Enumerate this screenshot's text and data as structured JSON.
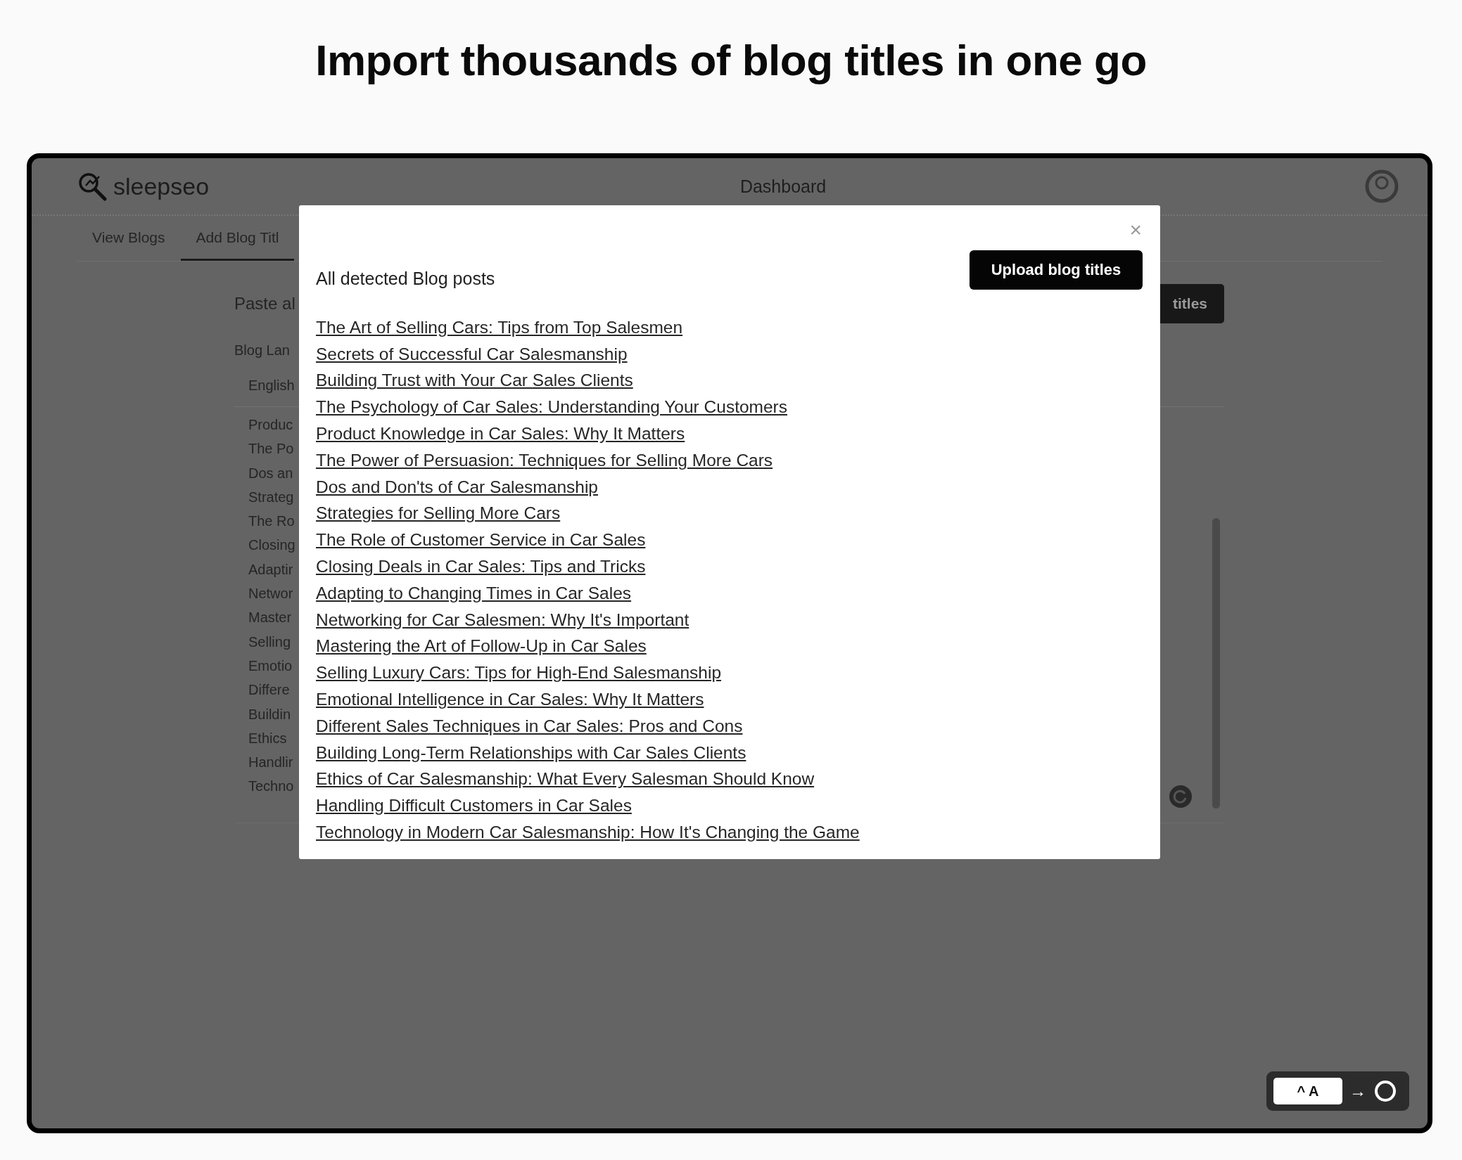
{
  "heading": "Import thousands of blog titles in one go",
  "app": {
    "logo": "sleepseo",
    "title": "Dashboard",
    "tabs": [
      {
        "label": "View Blogs",
        "selected": false
      },
      {
        "label": "Add Blog Titl",
        "selected": true
      }
    ],
    "form": {
      "prompt": "Paste al",
      "button": "titles",
      "language_label": "Blog Lan",
      "language_value": "English",
      "titles": [
        "Produc",
        "The Po",
        "Dos an",
        "Strateg",
        "The Ro",
        "Closing",
        "Adaptir",
        "Networ",
        "Master",
        "Selling",
        "Emotio",
        "Differe",
        "Buildin",
        "Ethics",
        "Handlir",
        "Techno"
      ]
    }
  },
  "modal": {
    "close": "×",
    "heading": "All detected Blog posts",
    "button": "Upload blog titles",
    "posts": [
      "The Art of Selling Cars: Tips from Top Salesmen",
      "Secrets of Successful Car Salesmanship",
      "Building Trust with Your Car Sales Clients",
      "The Psychology of Car Sales: Understanding Your Customers",
      "Product Knowledge in Car Sales: Why It Matters",
      "The Power of Persuasion: Techniques for Selling More Cars",
      "Dos and Don'ts of Car Salesmanship",
      "Strategies for Selling More Cars",
      "The Role of Customer Service in Car Sales",
      "Closing Deals in Car Sales: Tips and Tricks",
      "Adapting to Changing Times in Car Sales",
      "Networking for Car Salesmen: Why It's Important",
      "Mastering the Art of Follow-Up in Car Sales",
      "Selling Luxury Cars: Tips for High-End Salesmanship",
      "Emotional Intelligence in Car Sales: Why It Matters",
      "Different Sales Techniques in Car Sales: Pros and Cons",
      "Building Long-Term Relationships with Car Sales Clients",
      "Ethics of Car Salesmanship: What Every Salesman Should Know",
      "Handling Difficult Customers in Car Sales",
      "Technology in Modern Car Salesmanship: How It's Changing the Game"
    ]
  },
  "shortcut": {
    "keys": "^ A",
    "arrow": "→"
  }
}
